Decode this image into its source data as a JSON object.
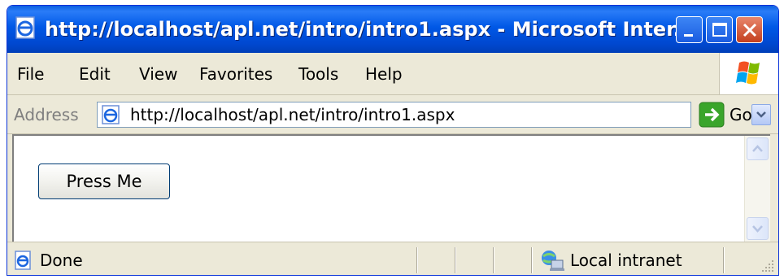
{
  "window": {
    "title": "http://localhost/apl.net/intro/intro1.aspx - Microsoft Inter..."
  },
  "menubar": {
    "items": [
      {
        "label": "File"
      },
      {
        "label": "Edit"
      },
      {
        "label": "View"
      },
      {
        "label": "Favorites"
      },
      {
        "label": "Tools"
      },
      {
        "label": "Help"
      }
    ]
  },
  "addressbar": {
    "label": "Address",
    "url": "http://localhost/apl.net/intro/intro1.aspx",
    "go_label": "Go"
  },
  "content": {
    "button_label": "Press Me"
  },
  "statusbar": {
    "status": "Done",
    "zone": "Local intranet"
  },
  "icons": {
    "title": "ie-page-icon",
    "address": "ie-page-icon",
    "go": "green-arrow-icon",
    "zone": "local-intranet-icon",
    "status": "ie-page-icon"
  },
  "colors": {
    "titlebar": "#0058e6",
    "chrome": "#ece9d8",
    "close_button": "#c4401f",
    "go_button": "#3aa52b"
  }
}
